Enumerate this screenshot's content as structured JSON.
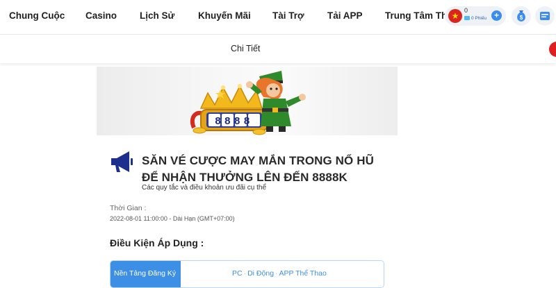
{
  "nav": {
    "items": [
      "Chung Cuộc",
      "Casino",
      "Lịch Sử",
      "Khuyến Mãi",
      "Tài Trợ",
      "Tải APP",
      "Trung Tâm Thành Viên"
    ]
  },
  "user": {
    "balance": "0",
    "tickets": "0 Phiếu",
    "flag_icon": "vietnam-flag-icon"
  },
  "subheader": {
    "title": "Chi Tiết"
  },
  "promo": {
    "banner_digits": "8888",
    "title_line1": "SĂN VÉ CƯỢC MAY MẮN TRONG NỔ HŨ",
    "title_line2": "ĐỂ NHẬN THƯỞNG LÊN ĐẾN 8888K",
    "subtitle": "Các quy tắc và điều khoản ưu đãi cụ thể",
    "time_label": "Thời Gian :",
    "time_value": "2022-08-01 11:00:00 - Dài Hạn (GMT+07:00)",
    "conditions_heading": "Điều Kiện Áp Dụng :",
    "platform_label": "Nền Tảng Đăng Ký",
    "platforms": [
      "PC",
      "Di Động",
      "APP Thể Thao"
    ]
  },
  "colors": {
    "accent": "#3d8fe6",
    "nav_text": "#1f1f1f",
    "alert": "#e02020"
  }
}
